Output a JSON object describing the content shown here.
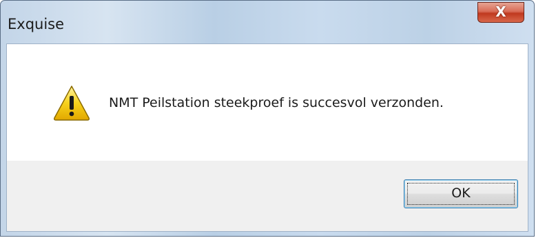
{
  "window": {
    "title": "Exquise",
    "close_glyph": "X"
  },
  "dialog": {
    "icon": "warning-icon",
    "message": "NMT Peilstation steekproef is succesvol verzonden.",
    "ok_label": "OK"
  },
  "colors": {
    "warning_yellow": "#f5c400",
    "button_focus_border": "#3c7fb1",
    "close_red": "#c0391f"
  }
}
